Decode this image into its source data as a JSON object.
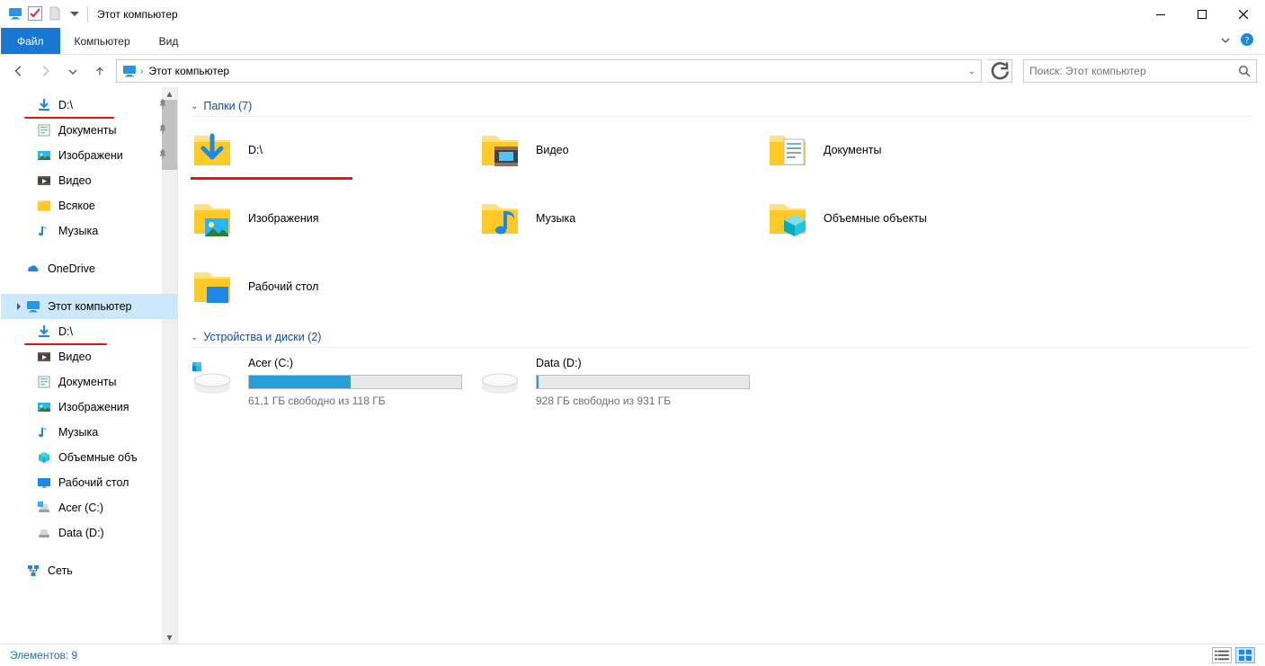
{
  "title": "Этот компьютер",
  "ribbon": {
    "file": "Файл",
    "tabs": [
      "Компьютер",
      "Вид"
    ]
  },
  "breadcrumb": {
    "location": "Этот компьютер"
  },
  "search": {
    "placeholder": "Поиск: Этот компьютер"
  },
  "sidebar": {
    "quick": [
      {
        "label": "D:\\",
        "icon": "download",
        "pinned": true,
        "underline": true
      },
      {
        "label": "Документы",
        "icon": "doc",
        "pinned": true
      },
      {
        "label": "Изображени",
        "icon": "image",
        "pinned": true
      },
      {
        "label": "Видео",
        "icon": "video",
        "pinned": false
      },
      {
        "label": "Всякое",
        "icon": "folder",
        "pinned": false
      },
      {
        "label": "Музыка",
        "icon": "music",
        "pinned": false
      }
    ],
    "onedrive": {
      "label": "OneDrive"
    },
    "thispc": {
      "label": "Этот компьютер",
      "children": [
        {
          "label": "D:\\",
          "icon": "download",
          "underline": true
        },
        {
          "label": "Видео",
          "icon": "video"
        },
        {
          "label": "Документы",
          "icon": "doc"
        },
        {
          "label": "Изображения",
          "icon": "image"
        },
        {
          "label": "Музыка",
          "icon": "music"
        },
        {
          "label": "Объемные объ",
          "icon": "cube"
        },
        {
          "label": "Рабочий стол",
          "icon": "desktop"
        },
        {
          "label": "Acer (C:)",
          "icon": "drive-c"
        },
        {
          "label": "Data (D:)",
          "icon": "drive"
        }
      ]
    },
    "network": {
      "label": "Сеть"
    }
  },
  "main": {
    "folders_header": "Папки (7)",
    "folders": [
      {
        "label": "D:\\",
        "icon": "download",
        "underline": true
      },
      {
        "label": "Видео",
        "icon": "video"
      },
      {
        "label": "Документы",
        "icon": "doc"
      },
      {
        "label": "Изображения",
        "icon": "image"
      },
      {
        "label": "Музыка",
        "icon": "music"
      },
      {
        "label": "Объемные объекты",
        "icon": "cube"
      },
      {
        "label": "Рабочий стол",
        "icon": "desktop"
      }
    ],
    "drives_header": "Устройства и диски (2)",
    "drives": [
      {
        "name": "Acer (C:)",
        "free": "61,1 ГБ свободно из 118 ГБ",
        "used_pct": 48,
        "system": true
      },
      {
        "name": "Data (D:)",
        "free": "928 ГБ свободно из 931 ГБ",
        "used_pct": 1,
        "system": false
      }
    ]
  },
  "status": {
    "text": "Элементов: 9"
  }
}
